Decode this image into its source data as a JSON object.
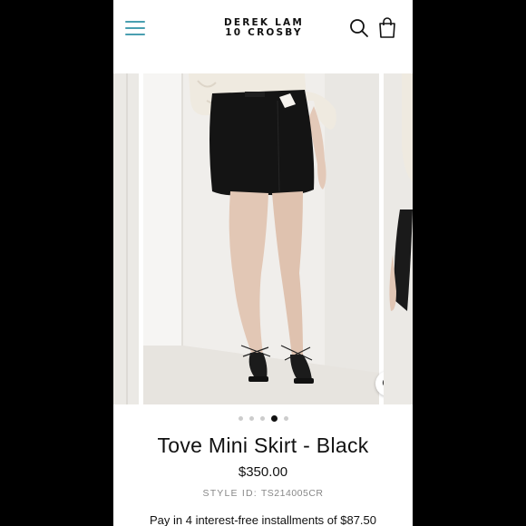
{
  "header": {
    "logo_line1": "DEREK LAM",
    "logo_line2": "10 CROSBY",
    "menu_icon": "hamburger-menu-icon",
    "search_icon": "search-icon",
    "cart_icon": "shopping-bag-icon",
    "accent_color": "#4a9fb0"
  },
  "gallery": {
    "zoom_icon": "zoom-in-icon",
    "slide_count": 5,
    "active_slide": 4
  },
  "product": {
    "title": "Tove Mini Skirt - Black",
    "price": "$350.00",
    "style_label": "STYLE ID:",
    "style_value": "TS214005CR",
    "installments": "Pay in 4 interest-free installments of $87.50"
  }
}
